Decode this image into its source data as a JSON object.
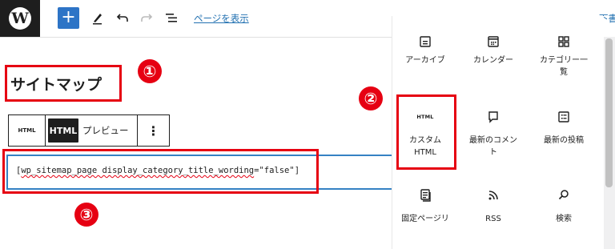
{
  "toolbar": {
    "logo_letter": "W",
    "add_label": "+",
    "view_page_link": "ページを表示",
    "cut_off_text": "下書"
  },
  "title": "サイトマップ",
  "annotations": [
    "①",
    "②",
    "③"
  ],
  "block_toolbar": {
    "html_small": "HTML",
    "html_active": "HTML",
    "preview_label": "プレビュー",
    "more_label": "⋮"
  },
  "code": {
    "prefix": "[",
    "shortcode": "wp_sitemap_page display_category_title_wording",
    "suffix": "=\"false\"]"
  },
  "inserter": {
    "items": [
      {
        "label": "アーカイブ",
        "icon": "archive-icon"
      },
      {
        "label": "カレンダー",
        "icon": "calendar-icon"
      },
      {
        "label": "カテゴリー一\n覧",
        "icon": "categories-icon"
      },
      {
        "label": "カスタム\nHTML",
        "icon": "html-icon",
        "badge": "HTML"
      },
      {
        "label": "最新のコメン\nト",
        "icon": "comment-icon"
      },
      {
        "label": "最新の投稿",
        "icon": "posts-icon"
      },
      {
        "label": "固定ページリ",
        "icon": "page-list-icon"
      },
      {
        "label": "RSS",
        "icon": "rss-icon"
      },
      {
        "label": "検索",
        "icon": "search-icon"
      }
    ]
  },
  "colors": {
    "accent": "#2d74c6",
    "highlight_red": "#e60012",
    "logo_bg": "#1e1e1e"
  }
}
